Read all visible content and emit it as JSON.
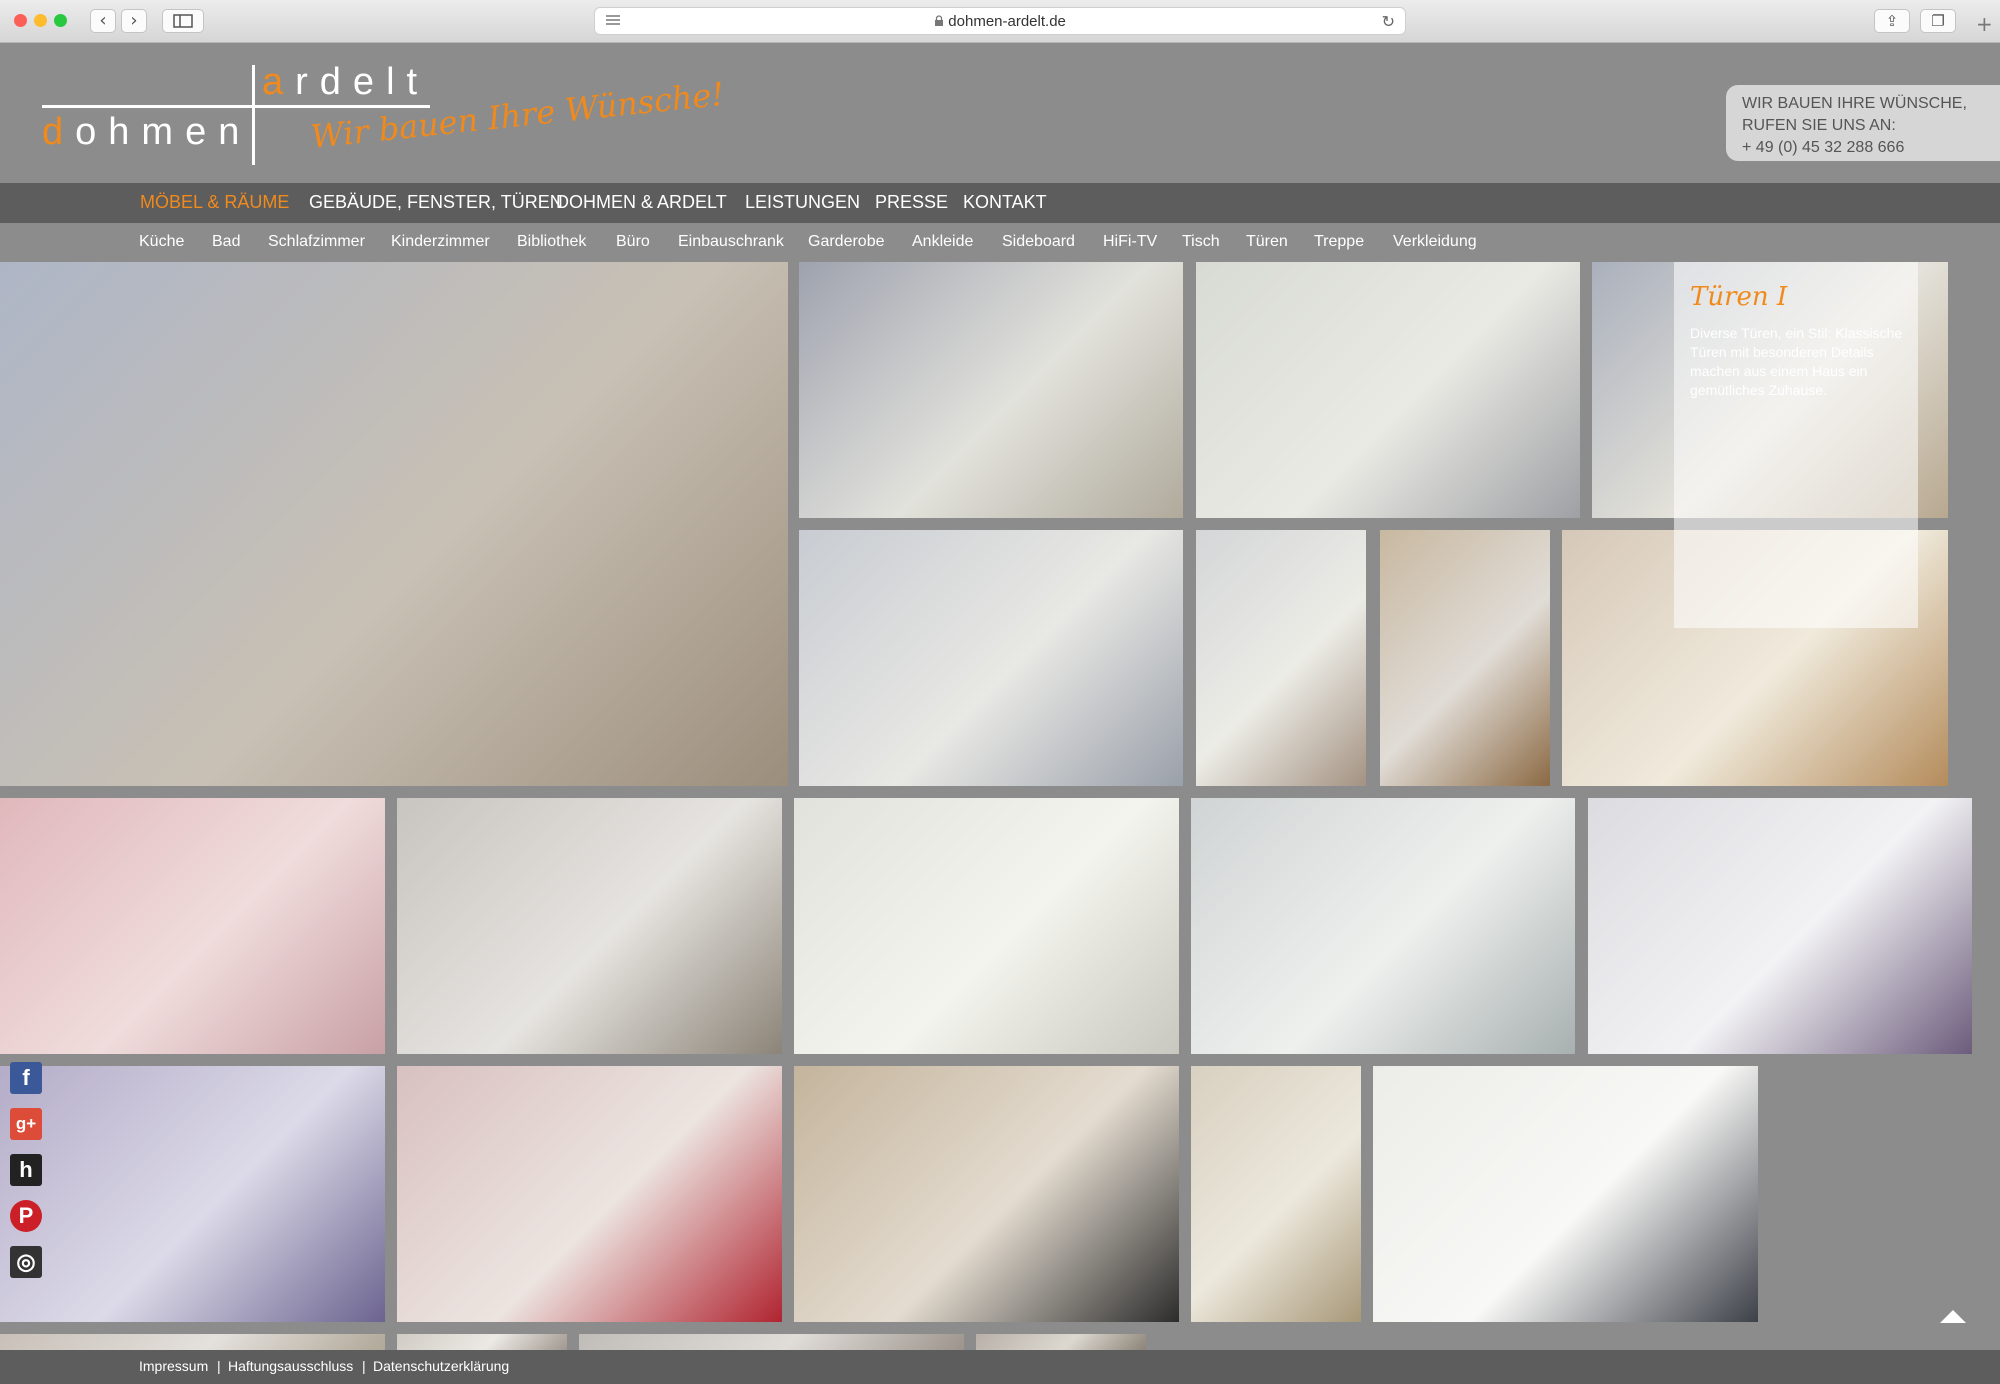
{
  "browser": {
    "url": "dohmen-ardelt.de",
    "traffic_lights": [
      "#fc5f57",
      "#fdbc2e",
      "#28c840"
    ],
    "icons": [
      "back-icon",
      "forward-icon",
      "sidebar-icon",
      "reader-icon",
      "lock-icon",
      "reload-icon",
      "share-icon",
      "tabs-icon",
      "new-tab-icon"
    ]
  },
  "logo": {
    "top_word": "ardelt",
    "bottom_word": "dohmen",
    "slogan": "Wir bauen Ihre Wünsche!",
    "accent_color": "#f08a1c"
  },
  "contact": {
    "line1": "WIR BAUEN IHRE WÜNSCHE,",
    "line2": "RUFEN SIE UNS AN:",
    "phone": "+ 49 (0) 45 32 288 666"
  },
  "main_nav": [
    {
      "label": "MÖBEL & RÄUME",
      "active": true
    },
    {
      "label": "GEBÄUDE, FENSTER, TÜREN",
      "active": false
    },
    {
      "label": "DOHMEN & ARDELT",
      "active": false
    },
    {
      "label": "LEISTUNGEN",
      "active": false
    },
    {
      "label": "PRESSE",
      "active": false
    },
    {
      "label": "KONTAKT",
      "active": false
    }
  ],
  "sub_nav": [
    "Küche",
    "Bad",
    "Schlafzimmer",
    "Kinderzimmer",
    "Bibliothek",
    "Büro",
    "Einbauschrank",
    "Garderobe",
    "Ankleide",
    "Sideboard",
    "HiFi-TV",
    "Tisch",
    "Türen",
    "Treppe",
    "Verkleidung"
  ],
  "info_panel": {
    "title": "Türen I",
    "description": "Diverse Türen, ein Stil: Klassische Türen mit besonderen Details machen aus einem Haus ein gemütliches Zuhause."
  },
  "gallery_photos": [
    {
      "name": "hallway-plaid-wallpaper",
      "colors": [
        "#aeb6c6",
        "#c8c0b4",
        "#9c8e7c"
      ]
    },
    {
      "name": "door-with-round-window",
      "colors": [
        "#9ea2ae",
        "#e2e2dc",
        "#b0aa9c"
      ]
    },
    {
      "name": "round-frosted-window-detail",
      "colors": [
        "#d8dad4",
        "#eaeae4",
        "#9ea0a4"
      ]
    },
    {
      "name": "door-plaid-room",
      "colors": [
        "#aab0bc",
        "#e4e2da",
        "#b8a890"
      ]
    },
    {
      "name": "bathroom-door-glass",
      "colors": [
        "#c8ccd2",
        "#e8e8e4",
        "#9aa0aa"
      ]
    },
    {
      "name": "white-hallway-door",
      "colors": [
        "#d4d6d8",
        "#ecece6",
        "#a49282"
      ]
    },
    {
      "name": "wooden-door-hallway",
      "colors": [
        "#c8b8a0",
        "#e0dcd6",
        "#8c6a44"
      ]
    },
    {
      "name": "climbing-wall-room",
      "colors": [
        "#d6c8b8",
        "#f0eadc",
        "#b48c5c"
      ]
    },
    {
      "name": "pink-wall-door-frame",
      "colors": [
        "#e0b8bc",
        "#f0dcdc",
        "#c8a0a6"
      ]
    },
    {
      "name": "hallway-gallery-wall",
      "colors": [
        "#c8c4c0",
        "#e6e4e0",
        "#8c8478"
      ]
    },
    {
      "name": "badkamer-door-sign",
      "colors": [
        "#e2e2dc",
        "#f4f4ee",
        "#c8c8c0"
      ]
    },
    {
      "name": "frosted-glass-door-blur",
      "colors": [
        "#d0d4d4",
        "#eef0ee",
        "#a8b0b0"
      ]
    },
    {
      "name": "porcelain-door-knob",
      "colors": [
        "#dcdce0",
        "#f2f2f4",
        "#6c5c7c"
      ]
    },
    {
      "name": "curtain-window-kids-room",
      "colors": [
        "#b4acc8",
        "#dcdae8",
        "#6c6490"
      ]
    },
    {
      "name": "kids-bedroom-red-rug",
      "colors": [
        "#d8c0c0",
        "#ece4e0",
        "#b02430"
      ]
    },
    {
      "name": "tiled-hallway-black-door",
      "colors": [
        "#c4b49c",
        "#e4dcd0",
        "#2c2c2c"
      ]
    },
    {
      "name": "white-door-glass-panes",
      "colors": [
        "#d8d0c0",
        "#ece8dc",
        "#a89878"
      ]
    },
    {
      "name": "dark-door-frame-detail",
      "colors": [
        "#ecece8",
        "#f8f8f6",
        "#3c4048"
      ]
    },
    {
      "name": "partial-row-1",
      "colors": [
        "#c8c0b8",
        "#e4e0dc",
        "#b0a898"
      ]
    },
    {
      "name": "partial-row-2",
      "colors": [
        "#d0ccc4",
        "#ece8e4",
        "#a09890"
      ]
    },
    {
      "name": "partial-row-3",
      "colors": [
        "#c0bcb8",
        "#e0dcd8",
        "#9c948c"
      ]
    },
    {
      "name": "partial-row-4",
      "colors": [
        "#b8b0a8",
        "#dcd8d0",
        "#8c8478"
      ]
    }
  ],
  "social": [
    {
      "name": "facebook-icon",
      "glyph": "f",
      "color": "#3b5998"
    },
    {
      "name": "google-plus-icon",
      "glyph": "g+",
      "color": "#dd4b39"
    },
    {
      "name": "houzz-icon",
      "glyph": "h",
      "color": "#222222"
    },
    {
      "name": "pinterest-icon",
      "glyph": "P",
      "color": "#cb2027"
    },
    {
      "name": "instagram-icon",
      "glyph": "◎",
      "color": "#333333"
    }
  ],
  "footer": [
    "Impressum",
    "Haftungsausschluss",
    "Datenschutzerklärung"
  ],
  "footer_separator": "|"
}
